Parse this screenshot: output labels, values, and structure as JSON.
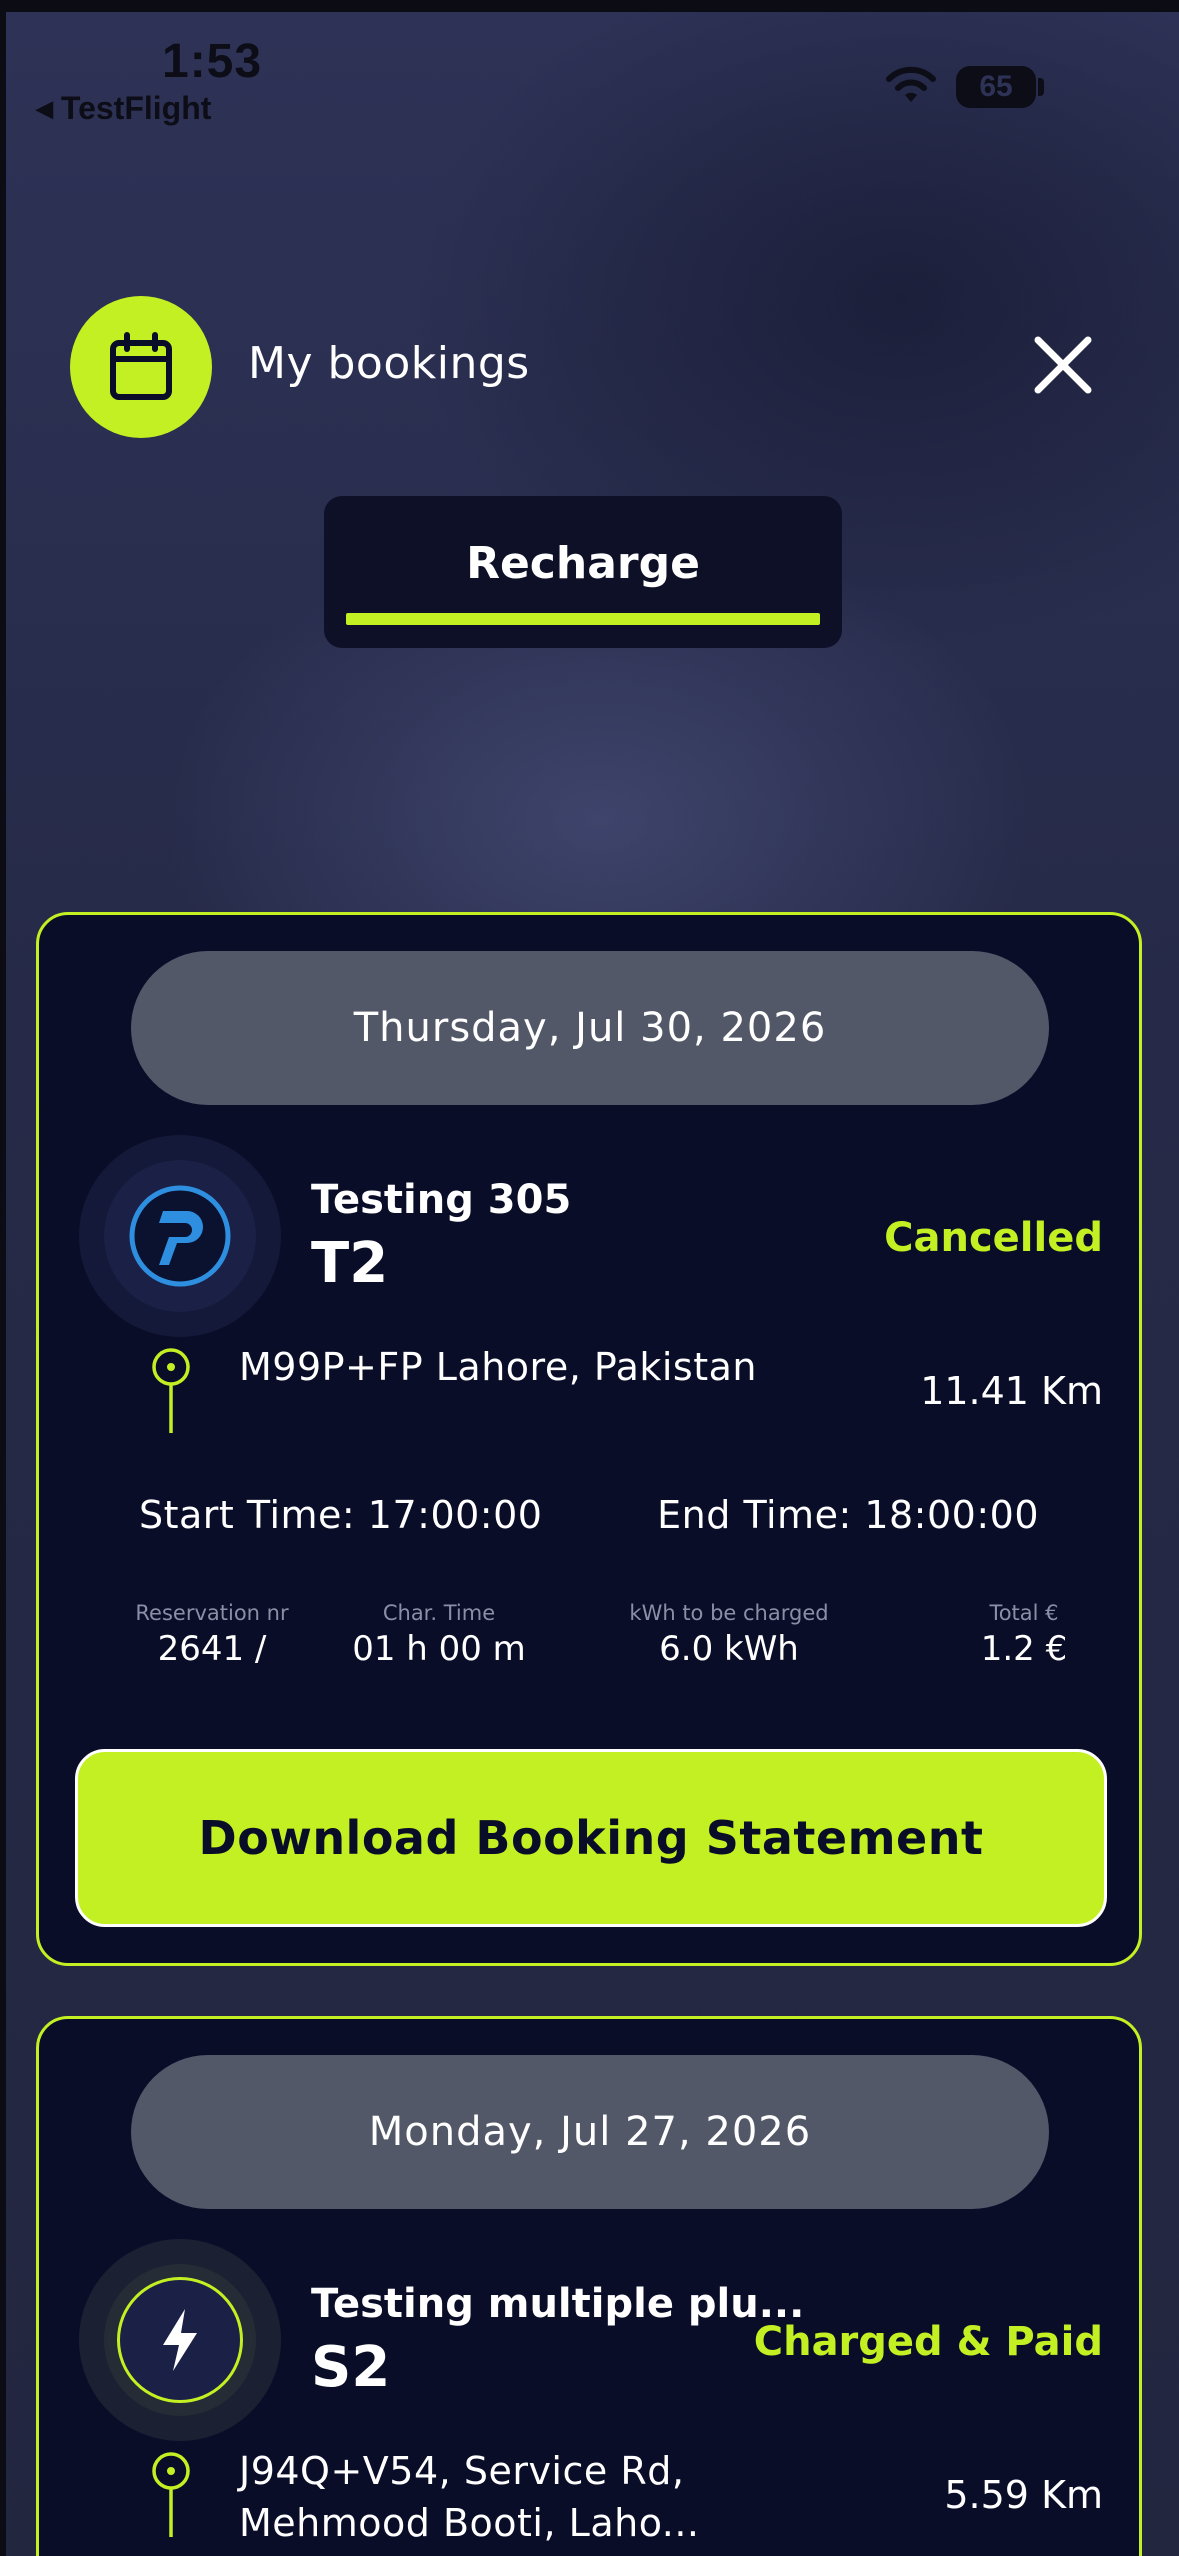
{
  "status_bar": {
    "time": "1:53",
    "back_label": "TestFlight",
    "battery": "65"
  },
  "header": {
    "title": "My bookings",
    "icon": "calendar-icon",
    "close_icon": "close-icon"
  },
  "tabs": [
    {
      "label": "Recharge",
      "active": true
    }
  ],
  "colors": {
    "accent": "#c3f022",
    "card_bg": "#0a0d28",
    "date_pill": "#535869",
    "background": "#2a2e50"
  },
  "bookings": [
    {
      "date": "Thursday, Jul 30, 2026",
      "station_name": "Testing 305",
      "station_code": "T2",
      "status": "Cancelled",
      "address": "M99P+FP Lahore, Pakistan",
      "distance": "11.41 Km",
      "start_time": "Start Time: 17:00:00",
      "end_time": "End Time: 18:00:00",
      "reservation_label": "Reservation nr",
      "reservation_value": "2641 /",
      "char_time_label": "Char. Time",
      "char_time_value": "01 h 00 m",
      "kwh_label": "kWh to be charged",
      "kwh_value": "6.0 kWh",
      "total_label": "Total €",
      "total_value": "1.2 €",
      "download_label": "Download Booking Statement"
    },
    {
      "date": "Monday, Jul 27, 2026",
      "station_name": "Testing multiple plu...",
      "station_code": "S2",
      "status": "Charged & Paid",
      "address": "J94Q+V54, Service Rd, Mehmood Booti, Laho...",
      "distance": "5.59 Km"
    }
  ]
}
